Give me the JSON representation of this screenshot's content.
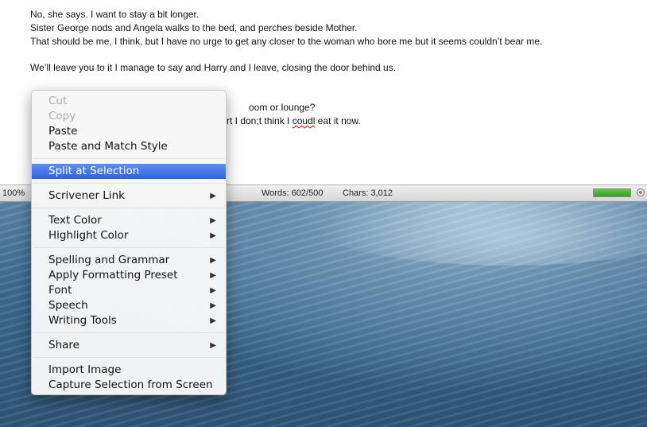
{
  "editor": {
    "lines": [
      "No, she says. I want to stay a bit longer.",
      "Sister George nods and Angela walks to the bed, and perches beside Mother.",
      "That should be me, I think, but I have no urge to get any closer to the woman who bore me but it seems couldn’t bear me.",
      "We’ll leave you to it I manage to say and Harry and I leave, closing the door behind us."
    ],
    "obscured_line_1_tail": "oom or lounge?",
    "obscured_line_2_mid": "rt I don;t think I ",
    "obscured_line_2_misspelled": "coudl",
    "obscured_line_2_end": " eat it now."
  },
  "status_bar": {
    "zoom": "100%",
    "words": "Words: 602/500",
    "chars": "Chars: 3,012",
    "target_progress_fraction": 1.0
  },
  "context_menu": {
    "groups": [
      [
        {
          "label": "Cut",
          "enabled": false,
          "submenu": false
        },
        {
          "label": "Copy",
          "enabled": false,
          "submenu": false
        },
        {
          "label": "Paste",
          "enabled": true,
          "submenu": false
        },
        {
          "label": "Paste and Match Style",
          "enabled": true,
          "submenu": false
        }
      ],
      [
        {
          "label": "Split at Selection",
          "enabled": true,
          "submenu": false,
          "highlighted": true
        }
      ],
      [
        {
          "label": "Scrivener Link",
          "enabled": true,
          "submenu": true
        }
      ],
      [
        {
          "label": "Text Color",
          "enabled": true,
          "submenu": true
        },
        {
          "label": "Highlight Color",
          "enabled": true,
          "submenu": true
        }
      ],
      [
        {
          "label": "Spelling and Grammar",
          "enabled": true,
          "submenu": true
        },
        {
          "label": "Apply Formatting Preset",
          "enabled": true,
          "submenu": true
        },
        {
          "label": "Font",
          "enabled": true,
          "submenu": true
        },
        {
          "label": "Speech",
          "enabled": true,
          "submenu": true
        },
        {
          "label": "Writing Tools",
          "enabled": true,
          "submenu": true
        }
      ],
      [
        {
          "label": "Share",
          "enabled": true,
          "submenu": true
        }
      ],
      [
        {
          "label": "Import Image",
          "enabled": true,
          "submenu": false
        },
        {
          "label": "Capture Selection from Screen",
          "enabled": true,
          "submenu": false
        }
      ]
    ],
    "submenu_arrow_glyph": "▶",
    "highlight_color": "#3a6fe6"
  },
  "colors": {
    "progress_fill": "#3fae2e",
    "misspelling_underline": "#dd0000"
  }
}
